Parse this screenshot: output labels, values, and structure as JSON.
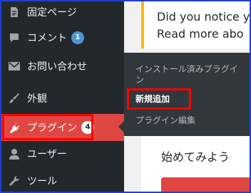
{
  "sidebar": {
    "items": [
      {
        "label": "固定ページ",
        "icon": "page-icon"
      },
      {
        "label": "コメント",
        "icon": "comment-icon",
        "badge": "1"
      },
      {
        "label": "お問い合わせ",
        "icon": "mail-icon"
      },
      {
        "label": "外観",
        "icon": "brush-icon"
      },
      {
        "label": "プラグイン",
        "icon": "plugin-icon",
        "badge": "4",
        "active": true
      },
      {
        "label": "ユーザー",
        "icon": "user-icon"
      },
      {
        "label": "ツール",
        "icon": "wrench-icon"
      }
    ]
  },
  "flyout": {
    "items": [
      {
        "label": "インストール済みプラグイン"
      },
      {
        "label": "新規追加",
        "selected": true
      },
      {
        "label": "プラグイン編集"
      }
    ]
  },
  "notice": {
    "line1": "Did you notice y",
    "line2": "Read more abo"
  },
  "panel": {
    "title": "始めてみよう"
  },
  "colors": {
    "sidebar_bg": "#23282d",
    "flyout_bg": "#32373c",
    "active_bg": "#e04743",
    "highlight_border": "#ff0000",
    "frame_border": "#1e3fd2",
    "badge_blue": "#4f94d4",
    "notice_border": "#ffb900"
  }
}
